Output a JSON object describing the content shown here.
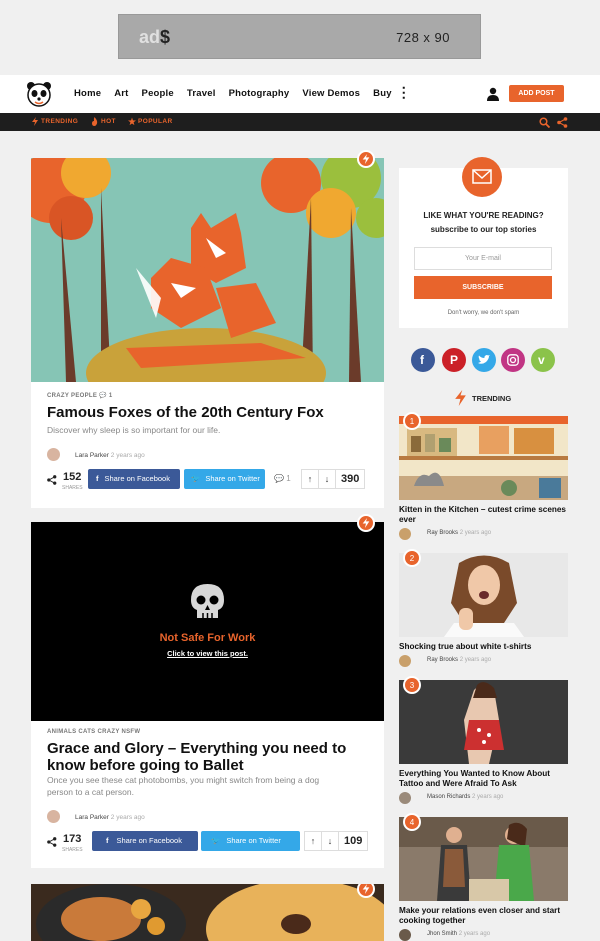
{
  "ad": {
    "logo_a": "ad",
    "logo_b": "$",
    "size": "728 x 90"
  },
  "header": {
    "nav": [
      "Home",
      "Art",
      "People",
      "Travel",
      "Photography",
      "View Demos",
      "Buy"
    ],
    "add_post": "ADD POST"
  },
  "subnav": {
    "trending": "TRENDING",
    "hot": "HOT",
    "popular": "POPULAR"
  },
  "posts": [
    {
      "cats": "CRAZY  PEOPLE",
      "comments": "1",
      "title": "Famous Foxes of the 20th Century Fox",
      "desc": "Discover why sleep is so important for our life.",
      "author": "Lara Parker",
      "time": "2 years ago",
      "shares": "152",
      "shares_label": "SHARES",
      "fb": "Share on Facebook",
      "tw": "Share on Twitter",
      "comment_count": "1",
      "votes": "390"
    },
    {
      "nsfw_title": "Not Safe For Work",
      "nsfw_link": "Click to view this post.",
      "cats": "ANIMALS  CATS  CRAZY  NSFW",
      "title": "Grace and Glory – Everything you need to know before going to Ballet",
      "desc": "Once you see these cat photobombs, you might switch from being a dog person to a cat person.",
      "author": "Lara Parker",
      "time": "2 years ago",
      "shares": "173",
      "shares_label": "SHARES",
      "fb": "Share on Facebook",
      "tw": "Share on Twitter",
      "votes": "109"
    }
  ],
  "newsletter": {
    "heading": "LIKE WHAT YOU'RE READING?",
    "sub": "subscribe to our top stories",
    "placeholder": "Your E-mail",
    "button": "SUBSCRIBE",
    "note": "Don't worry, we don't spam"
  },
  "social": [
    {
      "name": "facebook",
      "color": "#3b5998"
    },
    {
      "name": "pinterest",
      "color": "#cb2027"
    },
    {
      "name": "twitter",
      "color": "#34a8e8"
    },
    {
      "name": "instagram",
      "color": "#c13584"
    },
    {
      "name": "vimeo",
      "color": "#8bc34a"
    }
  ],
  "trending": {
    "heading": "TRENDING",
    "items": [
      {
        "num": "1",
        "title": "Kitten in the Kitchen – cutest crime scenes ever",
        "author": "Ray Brooks",
        "time": "2 years ago"
      },
      {
        "num": "2",
        "title": "Shocking true about white t-shirts",
        "author": "Ray Brooks",
        "time": "2 years ago"
      },
      {
        "num": "3",
        "title": "Everything You Wanted to Know About Tattoo and Were Afraid To Ask",
        "author": "Mason Richards",
        "time": "2 years ago"
      },
      {
        "num": "4",
        "title": "Make your relations even closer and start cooking together",
        "author": "Jhon Smith",
        "time": "2 years ago"
      }
    ]
  },
  "colors": {
    "accent": "#e8642c",
    "facebook": "#3b5998",
    "twitter": "#34a8e8"
  }
}
